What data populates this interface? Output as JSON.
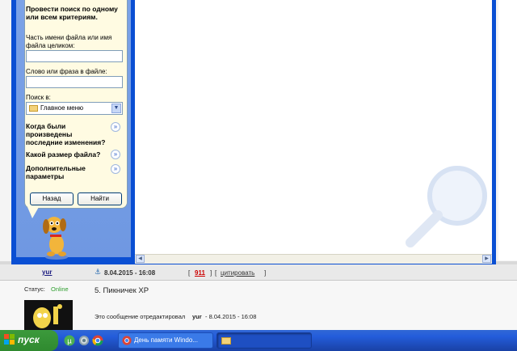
{
  "search_pane": {
    "heading": "Провести поиск по одному или всем критериям.",
    "filename_label": "Часть имени файла или имя файла целиком:",
    "filename_value": "",
    "phrase_label": "Слово или фраза в файле:",
    "phrase_value": "",
    "lookin_label": "Поиск в:",
    "lookin_value": "Главное меню",
    "when_modified": "Когда были произведены последние изменения?",
    "size": "Какой размер файла?",
    "more_options": "Дополнительные параметры",
    "back_button": "Назад",
    "search_button": "Найти"
  },
  "forum": {
    "author": "yur",
    "post_date": "8.04.2015 - 16:08",
    "post_number": "911",
    "quote_link": "цитировать",
    "status_label": "Статус:",
    "status_value": "Online",
    "post_title": "5. Пикничек XP",
    "edited_prefix": "Это сообщение отредактировал",
    "edited_user": "yur",
    "edited_date": "- 8.04.2015 - 16:08"
  },
  "taskbar": {
    "start_label": "пуск",
    "window_title": "День памяти Windo..."
  },
  "colors": {
    "xp_blue": "#0a4fd3",
    "start_green": "#2f8a2f",
    "post_number_red": "#cc0000",
    "online_green": "#2e9e2e"
  }
}
